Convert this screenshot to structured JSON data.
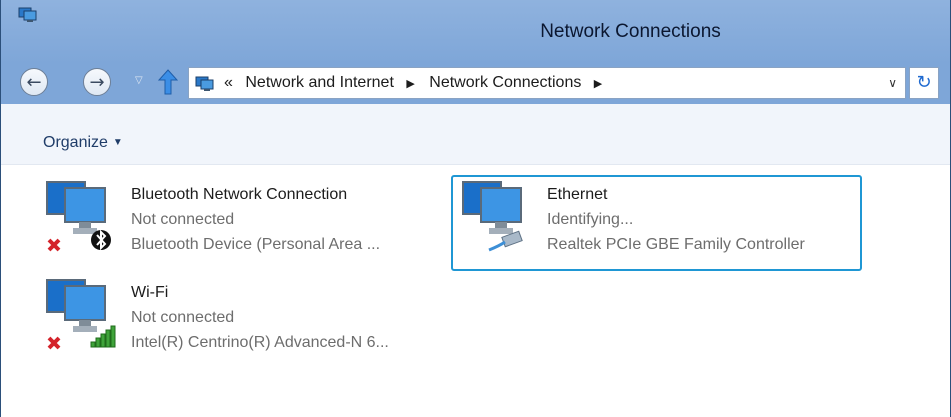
{
  "window": {
    "title": "Network Connections"
  },
  "nav": {
    "back_glyph": "←",
    "forward_glyph": "→",
    "dropdown_glyph": "▽",
    "refresh_glyph": "↻"
  },
  "address": {
    "overflow": "«",
    "crumbs": [
      "Network and Internet",
      "Network Connections"
    ],
    "separator": "▶",
    "dropdown": "∨"
  },
  "toolbar": {
    "organize_label": "Organize",
    "organize_caret": "▼"
  },
  "connections": [
    {
      "name": "Bluetooth Network Connection",
      "status": "Not connected",
      "device": "Bluetooth Device (Personal Area ...",
      "badge": "bluetooth-icon",
      "state": "disconnected"
    },
    {
      "name": "Ethernet",
      "status": "Identifying...",
      "device": "Realtek PCIe GBE Family Controller",
      "badge": "ethernet-cable-icon",
      "state": "identifying",
      "selected": true
    },
    {
      "name": "Wi-Fi",
      "status": "Not connected",
      "device": "Intel(R) Centrino(R) Advanced-N 6...",
      "badge": "wifi-signal-icon",
      "state": "disconnected"
    }
  ],
  "colors": {
    "selection": "#1f97d4",
    "titlebar": "#7ea6d8",
    "error": "#d4232b"
  }
}
